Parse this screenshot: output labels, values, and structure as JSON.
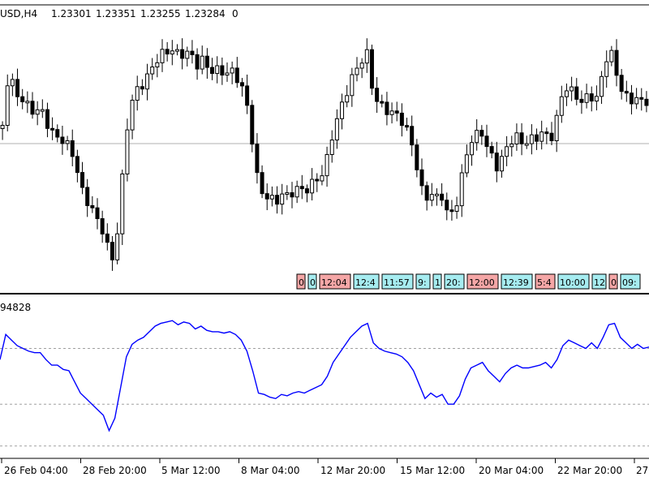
{
  "header": {
    "symbol_timeframe": "USD,H4",
    "open": "1.23301",
    "high": "1.23351",
    "low": "1.23255",
    "close": "1.23284",
    "volume": "0"
  },
  "indicator": {
    "value_label": "94828"
  },
  "colors": {
    "background": "#ffffff",
    "candle": "#000000",
    "indicator_line": "#0000ff",
    "level_line": "#a0a0a0",
    "tag_red": "#f4a6a6",
    "tag_cyan": "#a6ecf0",
    "frame": "#000000"
  },
  "time_labels": [
    "26 Feb 04:00",
    "28 Feb 20:00",
    "5 Mar 12:00",
    "8 Mar 04:00",
    "12 Mar 20:00",
    "15 Mar 12:00",
    "20 Mar 04:00",
    "22 Mar 20:00",
    "27"
  ],
  "trade_tags": [
    {
      "text": "0",
      "color": "red"
    },
    {
      "text": "0",
      "color": "cyan"
    },
    {
      "text": "12:04",
      "color": "red"
    },
    {
      "text": "12:4",
      "color": "cyan"
    },
    {
      "text": "11:57",
      "color": "cyan"
    },
    {
      "text": "9:",
      "color": "cyan"
    },
    {
      "text": "1",
      "color": "cyan"
    },
    {
      "text": "20:",
      "color": "cyan"
    },
    {
      "text": "12:00",
      "color": "red"
    },
    {
      "text": "12:39",
      "color": "cyan"
    },
    {
      "text": "5:4",
      "color": "red"
    },
    {
      "text": "10:00",
      "color": "cyan"
    },
    {
      "text": "12",
      "color": "cyan"
    },
    {
      "text": "0",
      "color": "red"
    },
    {
      "text": "09:",
      "color": "cyan"
    }
  ],
  "chart_data": {
    "type": "line",
    "series": [
      {
        "values": [
          62,
          80,
          76,
          72,
          70,
          68,
          67,
          67,
          62,
          58,
          58,
          55,
          54,
          46,
          38,
          34,
          30,
          26,
          22,
          11,
          20,
          42,
          64,
          73,
          76,
          78,
          82,
          86,
          88,
          89,
          90,
          87,
          89,
          88,
          84,
          86,
          83,
          82,
          82,
          81,
          82,
          80,
          76,
          68,
          54,
          38,
          37,
          35,
          34,
          37,
          36,
          38,
          39,
          38,
          40,
          42,
          44,
          50,
          60,
          66,
          72,
          78,
          82,
          86,
          88,
          74,
          70,
          68,
          67,
          66,
          64,
          60,
          54,
          44,
          34,
          38,
          35,
          37,
          30,
          30,
          36,
          48,
          56,
          58,
          60,
          54,
          50,
          46,
          52,
          56,
          58,
          56,
          56,
          57,
          58,
          60,
          56,
          62,
          72,
          76,
          74,
          72,
          70,
          74,
          70,
          78,
          87,
          88,
          78,
          74,
          70,
          73,
          70,
          71
        ]
      }
    ],
    "levels": [
      70,
      30,
      0
    ],
    "ylim": [
      -6,
      100
    ]
  }
}
